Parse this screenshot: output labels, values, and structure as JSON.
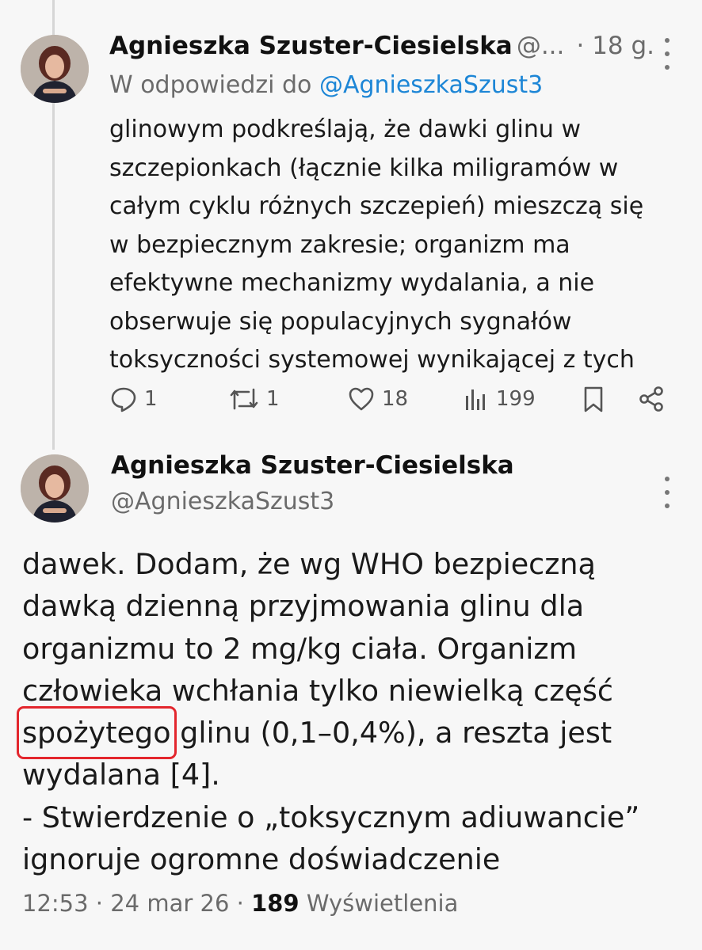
{
  "tweet1": {
    "author_name": "Agnieszka Szuster-Ciesielska",
    "handle_truncated": "@...",
    "time": "· 18 g.",
    "reply_prefix": "W odpowiedzi do",
    "reply_handle": "@AgnieszkaSzust3",
    "lines": [
      "glinowym podkreślają, że dawki glinu w",
      "szczepionkach (łącznie kilka miligramów w",
      "całym cyklu różnych szczepień) mieszczą się",
      "w bezpiecznym zakresie; organizm ma",
      "efektywne mechanizmy wydalania, a nie",
      "obserwuje się populacyjnych sygnałów",
      "toksyczności systemowej wynikającej z tych"
    ],
    "stats": {
      "replies": "1",
      "reposts": "1",
      "likes": "18",
      "views": "199"
    },
    "icons": [
      "avatar",
      "more-icon",
      "reply-icon",
      "repost-icon",
      "like-icon",
      "views-icon",
      "bookmark-icon",
      "share-icon"
    ]
  },
  "tweet2": {
    "author_name": "Agnieszka Szuster-Ciesielska",
    "handle": "@AgnieszkaSzust3",
    "lines": [
      "dawek. Dodam, że wg WHO bezpieczną",
      "dawką dzienną przyjmowania glinu dla",
      "organizmu to 2 mg/kg ciała. Organizm",
      "człowieka wchłania tylko niewielką część"
    ],
    "highlighted_word": "spożytego",
    "highlight_line_rest": " glinu (0,1–0,4%), a reszta jest",
    "lines_after": [
      "wydalana [4].",
      "- Stwierdzenie o „toksycznym adiuwancie”",
      "ignoruje ogromne doświadczenie"
    ],
    "footer_time": "12:53 · 24 mar 26 · ",
    "footer_views_count": "189",
    "footer_views_label": " Wyświetlenia"
  },
  "colors": {
    "background": "#f7f7f7",
    "link": "#1d86d6",
    "muted": "#6b6b6b",
    "highlight_box": "#e3262d"
  }
}
